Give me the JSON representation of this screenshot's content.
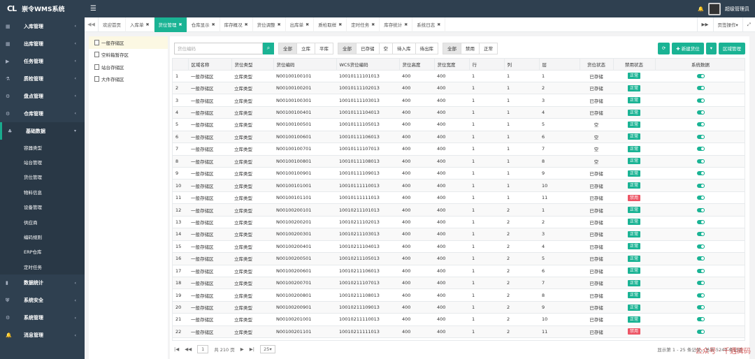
{
  "app": {
    "logo": "CL",
    "title": "崇令WMS系统",
    "menu_icon": "hamburger-icon",
    "bell_icon": "bell-icon",
    "user": "超级管理员"
  },
  "sidebar": {
    "items": [
      {
        "label": "入库管理",
        "icon": "grid-icon"
      },
      {
        "label": "出库管理",
        "icon": "grid-icon"
      },
      {
        "label": "任务管理",
        "icon": "play-icon"
      },
      {
        "label": "质检管理",
        "icon": "flask-icon"
      },
      {
        "label": "盘点管理",
        "icon": "cog-icon"
      },
      {
        "label": "仓库管理",
        "icon": "cogs-icon"
      },
      {
        "label": "基础数据",
        "icon": "sitemap-icon"
      }
    ],
    "subitems": [
      "容器类型",
      "站台管理",
      "货位管理",
      "物料信息",
      "设备管理",
      "供应商",
      "编码规则",
      "ERP仓库",
      "定时任务"
    ],
    "bottom": [
      {
        "label": "数据统计",
        "icon": "bar-chart-icon"
      },
      {
        "label": "系统安全",
        "icon": "shield-icon"
      },
      {
        "label": "系统管理",
        "icon": "cogs-icon"
      },
      {
        "label": "消息管理",
        "icon": "bell-icon"
      }
    ]
  },
  "tabs": [
    "欢迎首页",
    "入库单",
    "货位管理",
    "仓库显示",
    "库存概况",
    "货位调整",
    "出库单",
    "质检取样",
    "定时任务",
    "库存统计",
    "系统日志"
  ],
  "tab_actions": {
    "more": "页签操作▾",
    "fullscreen": "⤢"
  },
  "tree": [
    "一般存储区",
    "空料箱暂存区",
    "站台存储区",
    "大件存储区"
  ],
  "toolbar": {
    "search_placeholder": "货位编码",
    "group1": [
      "全部",
      "立库",
      "平库"
    ],
    "group2": [
      "全部",
      "已存储",
      "空",
      "待入库",
      "待出库"
    ],
    "group3": [
      "全部",
      "禁用",
      "正常"
    ],
    "new_btn": "✚ 新建货位",
    "area_btn": "区域管理"
  },
  "table": {
    "headers": [
      "",
      "区域名称",
      "货位类型",
      "货位编码",
      "WCS货位编码",
      "货位高度",
      "货位宽度",
      "行",
      "列",
      "层",
      "货位状态",
      "禁用状态",
      "系统数据"
    ],
    "rows": [
      [
        "1",
        "一般存储区",
        "立库类型",
        "N00100100101",
        "10010111101013",
        "400",
        "400",
        "1",
        "1",
        "1",
        "已存储",
        "正常"
      ],
      [
        "2",
        "一般存储区",
        "立库类型",
        "N00100100201",
        "10010111102013",
        "400",
        "400",
        "1",
        "1",
        "2",
        "已存储",
        "正常"
      ],
      [
        "3",
        "一般存储区",
        "立库类型",
        "N00100100301",
        "10010111103013",
        "400",
        "400",
        "1",
        "1",
        "3",
        "已存储",
        "正常"
      ],
      [
        "4",
        "一般存储区",
        "立库类型",
        "N00100100401",
        "10010111104013",
        "400",
        "400",
        "1",
        "1",
        "4",
        "已存储",
        "正常"
      ],
      [
        "5",
        "一般存储区",
        "立库类型",
        "N00100100501",
        "10010111105013",
        "400",
        "400",
        "1",
        "1",
        "5",
        "空",
        "正常"
      ],
      [
        "6",
        "一般存储区",
        "立库类型",
        "N00100100601",
        "10010111106013",
        "400",
        "400",
        "1",
        "1",
        "6",
        "空",
        "正常"
      ],
      [
        "7",
        "一般存储区",
        "立库类型",
        "N00100100701",
        "10010111107013",
        "400",
        "400",
        "1",
        "1",
        "7",
        "空",
        "正常"
      ],
      [
        "8",
        "一般存储区",
        "立库类型",
        "N00100100801",
        "10010111108013",
        "400",
        "400",
        "1",
        "1",
        "8",
        "空",
        "正常"
      ],
      [
        "9",
        "一般存储区",
        "立库类型",
        "N00100100901",
        "10010111109013",
        "400",
        "400",
        "1",
        "1",
        "9",
        "已存储",
        "正常"
      ],
      [
        "10",
        "一般存储区",
        "立库类型",
        "N00100101001",
        "10010111110013",
        "400",
        "400",
        "1",
        "1",
        "10",
        "已存储",
        "正常"
      ],
      [
        "11",
        "一般存储区",
        "立库类型",
        "N00100101101",
        "10010111111013",
        "400",
        "400",
        "1",
        "1",
        "11",
        "已存储",
        "禁用"
      ],
      [
        "12",
        "一般存储区",
        "立库类型",
        "N00100200101",
        "10010211101013",
        "400",
        "400",
        "1",
        "2",
        "1",
        "已存储",
        "正常"
      ],
      [
        "13",
        "一般存储区",
        "立库类型",
        "N00100200201",
        "10010211102013",
        "400",
        "400",
        "1",
        "2",
        "2",
        "已存储",
        "正常"
      ],
      [
        "14",
        "一般存储区",
        "立库类型",
        "N00100200301",
        "10010211103013",
        "400",
        "400",
        "1",
        "2",
        "3",
        "已存储",
        "正常"
      ],
      [
        "15",
        "一般存储区",
        "立库类型",
        "N00100200401",
        "10010211104013",
        "400",
        "400",
        "1",
        "2",
        "4",
        "已存储",
        "正常"
      ],
      [
        "16",
        "一般存储区",
        "立库类型",
        "N00100200501",
        "10010211105013",
        "400",
        "400",
        "1",
        "2",
        "5",
        "已存储",
        "正常"
      ],
      [
        "17",
        "一般存储区",
        "立库类型",
        "N00100200601",
        "10010211106013",
        "400",
        "400",
        "1",
        "2",
        "6",
        "已存储",
        "正常"
      ],
      [
        "18",
        "一般存储区",
        "立库类型",
        "N00100200701",
        "10010211107013",
        "400",
        "400",
        "1",
        "2",
        "7",
        "已存储",
        "正常"
      ],
      [
        "19",
        "一般存储区",
        "立库类型",
        "N00100200801",
        "10010211108013",
        "400",
        "400",
        "1",
        "2",
        "8",
        "已存储",
        "正常"
      ],
      [
        "20",
        "一般存储区",
        "立库类型",
        "N00100200901",
        "10010211109013",
        "400",
        "400",
        "1",
        "2",
        "9",
        "已存储",
        "正常"
      ],
      [
        "21",
        "一般存储区",
        "立库类型",
        "N00100201001",
        "10010211110013",
        "400",
        "400",
        "1",
        "2",
        "10",
        "已存储",
        "正常"
      ],
      [
        "22",
        "一般存储区",
        "立库类型",
        "N00100201101",
        "10010211111013",
        "400",
        "400",
        "1",
        "2",
        "11",
        "已存储",
        "禁用"
      ]
    ]
  },
  "pager": {
    "page": "1",
    "total": "共 210 页",
    "size": "25",
    "info": "显示第 1 - 25 条记录，总共 5240 条记录"
  },
  "watermark": "公众号 · 千遇碑码",
  "colors": {
    "sidebar": "#2f4050",
    "accent": "#1ab394",
    "danger": "#ed5565"
  }
}
